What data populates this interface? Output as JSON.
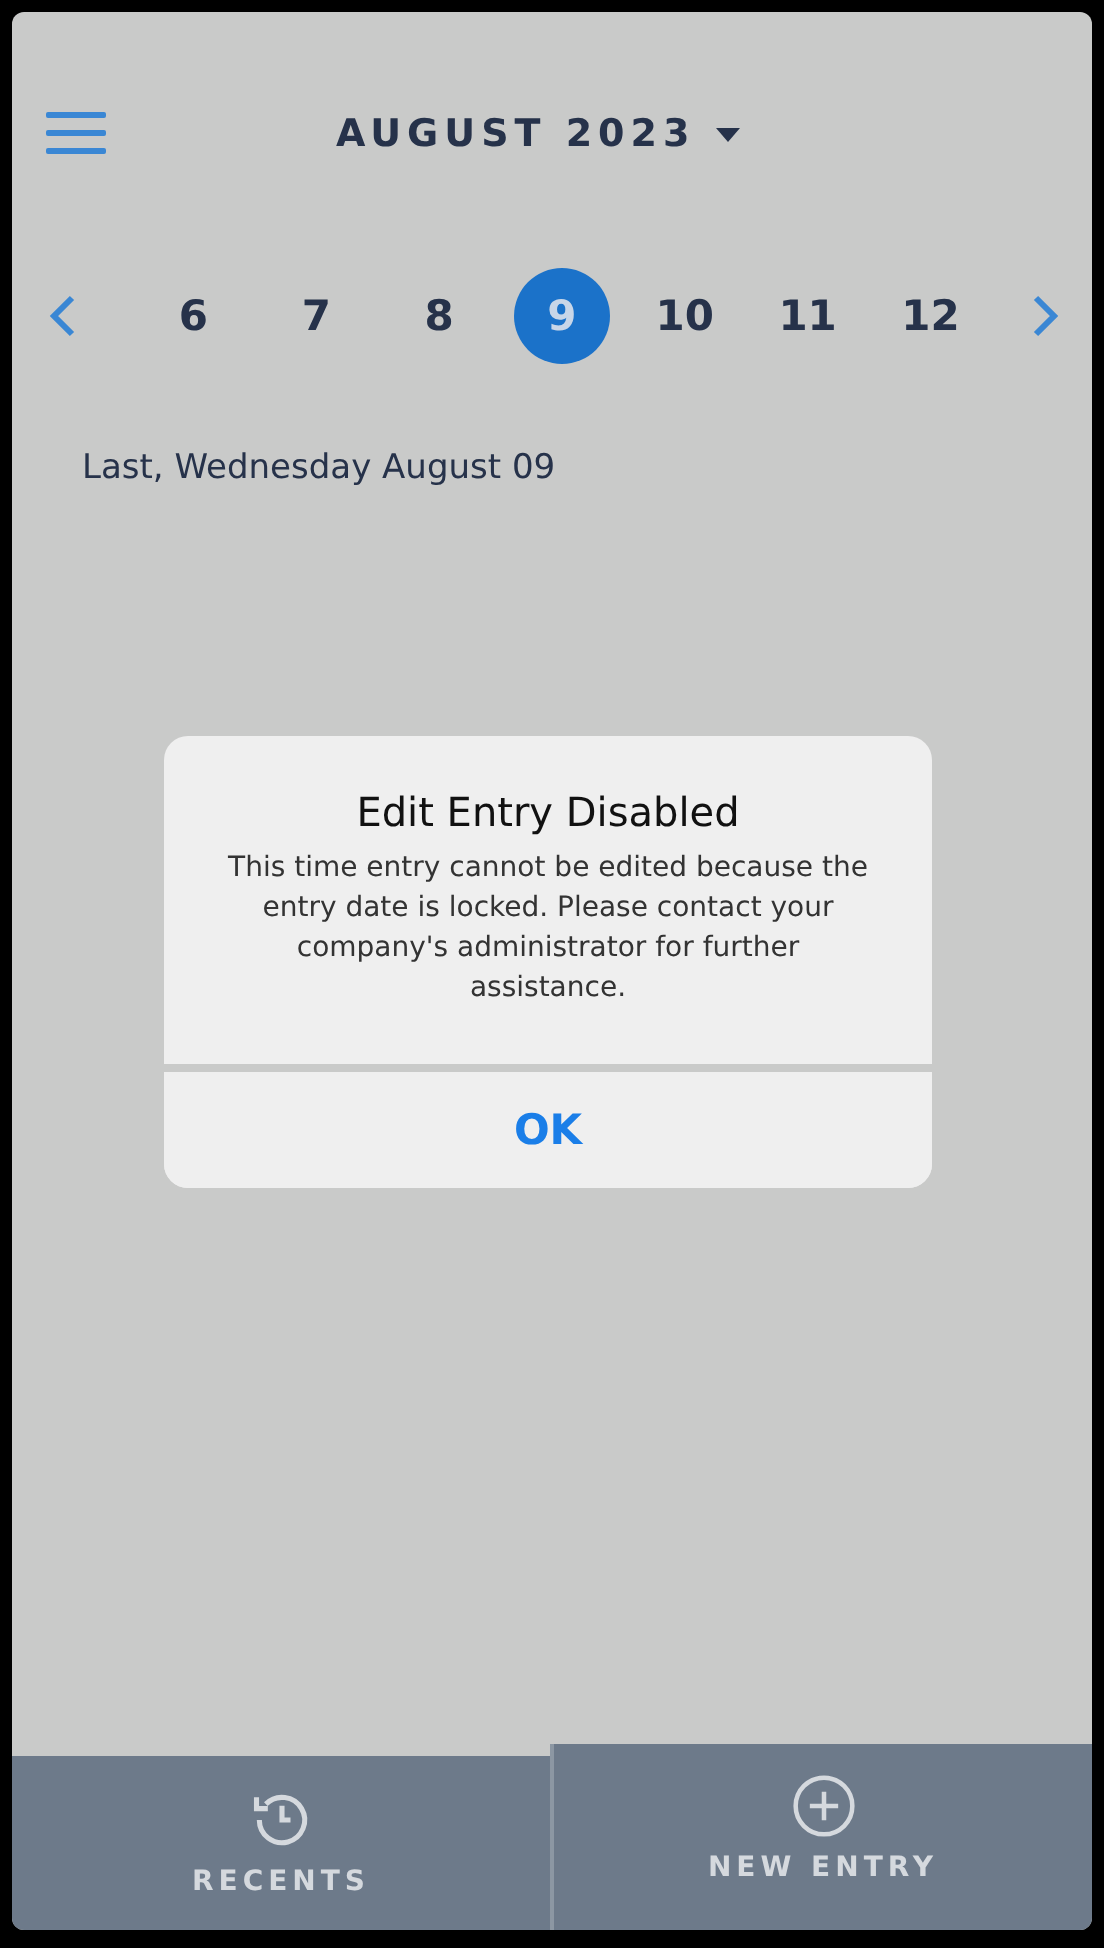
{
  "header": {
    "month": "AUGUST 2023"
  },
  "days": [
    {
      "label": "6",
      "selected": false
    },
    {
      "label": "7",
      "selected": false
    },
    {
      "label": "8",
      "selected": false
    },
    {
      "label": "9",
      "selected": true
    },
    {
      "label": "10",
      "selected": false
    },
    {
      "label": "11",
      "selected": false
    },
    {
      "label": "12",
      "selected": false
    }
  ],
  "date_label": "Last, Wednesday August 09",
  "dialog": {
    "title": "Edit Entry Disabled",
    "message": "This time entry cannot be edited because the entry date is locked. Please contact your company's administrator for further assistance.",
    "button": "OK"
  },
  "tabs": [
    {
      "label": "RECENTS",
      "kind": "recents",
      "selected": false
    },
    {
      "label": "NEW ENTRY",
      "kind": "new",
      "selected": true
    }
  ]
}
